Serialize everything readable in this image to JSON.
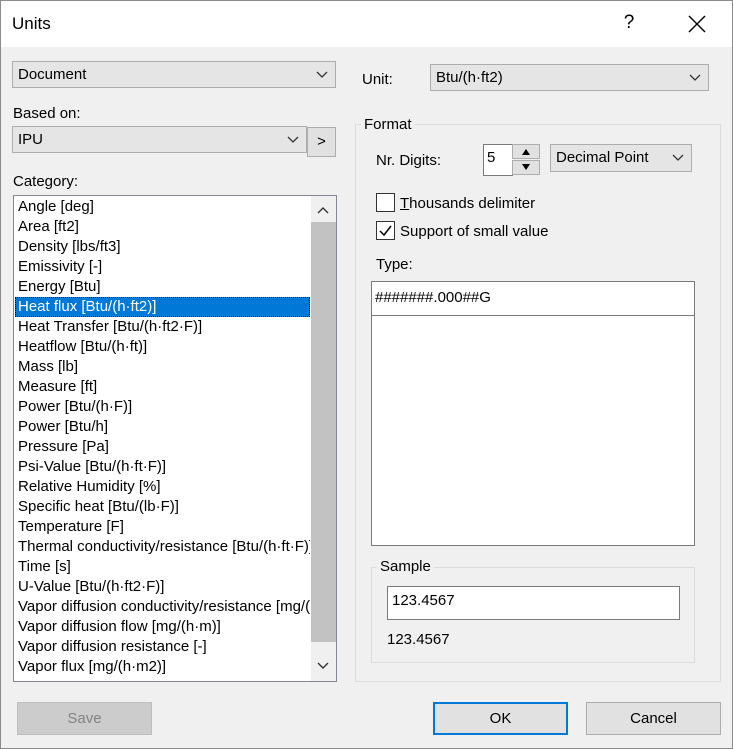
{
  "dialog": {
    "title": "Units",
    "help_symbol": "?"
  },
  "left": {
    "scope_value": "Document",
    "based_on_label": "Based on:",
    "based_on_value": "IPU",
    "apply_button": ">",
    "category_label": "Category:",
    "categories": [
      "Angle [deg]",
      "Area [ft2]",
      "Density [lbs/ft3]",
      "Emissivity [-]",
      "Energy [Btu]",
      "Heat flux [Btu/(h·ft2)]",
      "Heat Transfer [Btu/(h·ft2·F)]",
      "Heatflow [Btu/(h·ft)]",
      "Mass [lb]",
      "Measure [ft]",
      "Power [Btu/(h·F)]",
      "Power [Btu/h]",
      "Pressure [Pa]",
      "Psi-Value [Btu/(h·ft·F)]",
      "Relative Humidity [%]",
      "Specific heat [Btu/(lb·F)]",
      "Temperature [F]",
      "Thermal conductivity/resistance [Btu/(h·ft·F)]",
      "Time [s]",
      "U-Value [Btu/(h·ft2·F)]",
      "Vapor diffusion conductivity/resistance [mg/(h·m·Pa)]",
      "Vapor diffusion flow [mg/(h·m)]",
      "Vapor diffusion resistance [-]",
      "Vapor flux [mg/(h·m2)]"
    ],
    "selected_index": 5
  },
  "right": {
    "unit_label": "Unit:",
    "unit_value": "Btu/(h·ft2)",
    "format_group": "Format",
    "nr_digits_label": "Nr. Digits:",
    "nr_digits_value": "5",
    "decimal_value": "Decimal Point",
    "thousands_label": "Thousands delimiter",
    "thousands_checked": false,
    "small_values_label": "Support of small value",
    "small_values_checked": true,
    "type_label": "Type:",
    "type_value": "#######.000##G",
    "sample_group": "Sample",
    "sample_input": "123.4567",
    "sample_output": "123.4567"
  },
  "buttons": {
    "save": "Save",
    "ok": "OK",
    "cancel": "Cancel"
  }
}
